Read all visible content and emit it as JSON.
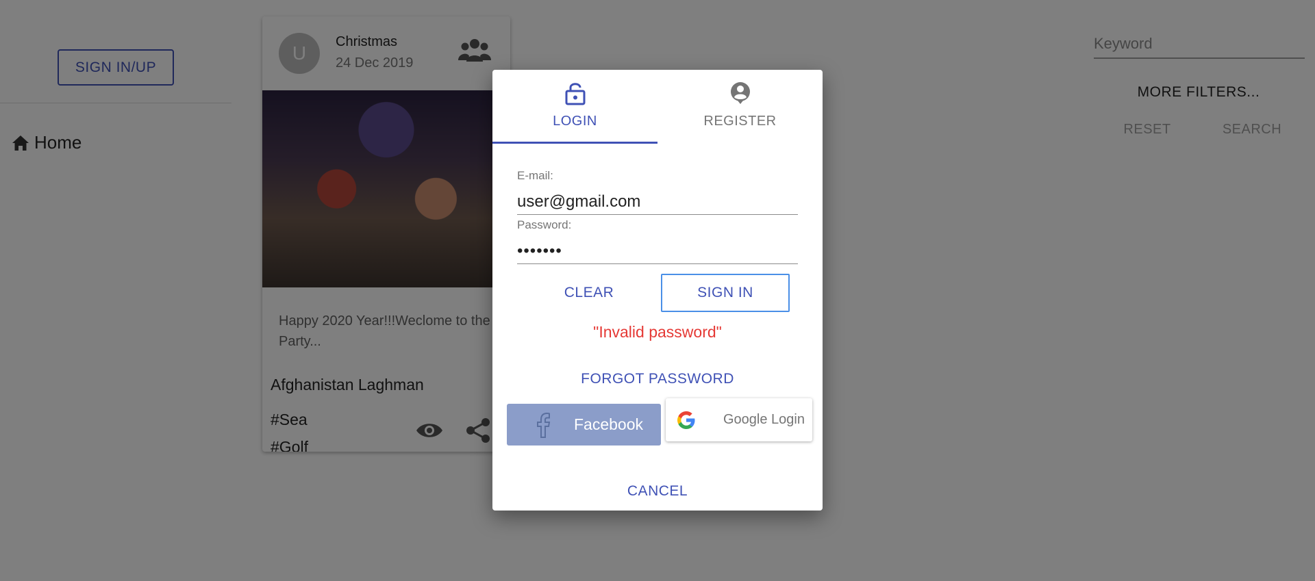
{
  "sidebar": {
    "signin_label": "SIGN IN/UP",
    "home_label": "Home"
  },
  "card": {
    "avatar_letter": "U",
    "title": "Christmas",
    "date": "24 Dec 2019",
    "description": "Happy 2020 Year!!!Weclome to the Party...",
    "location": "Afghanistan Laghman",
    "tags": [
      "#Sea",
      "#Golf"
    ]
  },
  "filters": {
    "keyword_placeholder": "Keyword",
    "more_filters_label": "MORE FILTERS...",
    "reset_label": "RESET",
    "search_label": "SEARCH"
  },
  "dialog": {
    "tabs": [
      {
        "label": "LOGIN",
        "icon": "lock-open-icon",
        "active": true
      },
      {
        "label": "REGISTER",
        "icon": "account-circle-icon",
        "active": false
      }
    ],
    "email_label": "E-mail:",
    "email_value": "user@gmail.com",
    "password_label": "Password:",
    "password_value": "•••••••",
    "clear_label": "CLEAR",
    "signin_label": "SIGN IN",
    "error_message": "\"Invalid password\"",
    "forgot_label": "FORGOT PASSWORD",
    "facebook_label": "Facebook",
    "google_label": "Google Login",
    "cancel_label": "CANCEL"
  },
  "colors": {
    "primary": "#3f51b5",
    "error": "#e53935",
    "facebook": "#8b9dc9",
    "signin_border": "#4a8fe7"
  }
}
